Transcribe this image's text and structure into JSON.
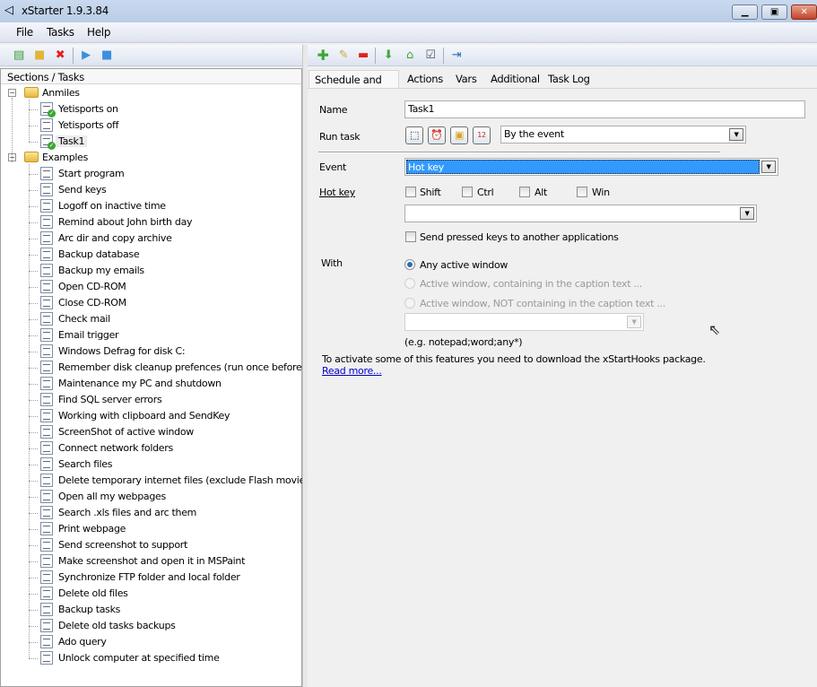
{
  "window": {
    "title": "xStarter 1.9.3.84",
    "controls": [
      "minimize",
      "maximize",
      "close"
    ]
  },
  "menu": [
    "File",
    "Tasks",
    "Help"
  ],
  "left_toolbar": [
    {
      "icon": "new-task-icon"
    },
    {
      "icon": "new-section-icon"
    },
    {
      "icon": "delete-icon"
    },
    {
      "icon": "run-icon"
    },
    {
      "icon": "stop-icon"
    }
  ],
  "right_toolbar": [
    {
      "icon": "add-icon"
    },
    {
      "icon": "edit-icon"
    },
    {
      "icon": "remove-icon"
    },
    {
      "icon": "move-down-icon"
    },
    {
      "icon": "move-up-icon"
    },
    {
      "icon": "checklist-icon"
    },
    {
      "icon": "step-run-icon"
    }
  ],
  "tree": {
    "header": "Sections / Tasks",
    "sections": [
      {
        "label": "Anmiles",
        "items": [
          {
            "label": "Yetisports on",
            "enabled": true
          },
          {
            "label": "Yetisports off",
            "enabled": false
          },
          {
            "label": "Task1",
            "enabled": true,
            "selected": true
          }
        ]
      },
      {
        "label": "Examples",
        "items": [
          {
            "label": "Start program"
          },
          {
            "label": "Send keys"
          },
          {
            "label": "Logoff on inactive time"
          },
          {
            "label": "Remind about John birth day"
          },
          {
            "label": "Arc dir and copy archive"
          },
          {
            "label": "Backup database"
          },
          {
            "label": "Backup my emails"
          },
          {
            "label": "Open CD-ROM"
          },
          {
            "label": "Close CD-ROM"
          },
          {
            "label": "Check mail"
          },
          {
            "label": "Email trigger"
          },
          {
            "label": "Windows Defrag for disk C:"
          },
          {
            "label": "Remember disk cleanup prefences (run once before ..."
          },
          {
            "label": "Maintenance my PC and shutdown"
          },
          {
            "label": "Find SQL server errors"
          },
          {
            "label": "Working with clipboard and SendKey"
          },
          {
            "label": "ScreenShot of active window"
          },
          {
            "label": "Connect network folders"
          },
          {
            "label": "Search files"
          },
          {
            "label": "Delete temporary internet files (exclude Flash movies)"
          },
          {
            "label": "Open all my webpages"
          },
          {
            "label": "Search .xls files and arc them"
          },
          {
            "label": "Print webpage"
          },
          {
            "label": "Send screenshot to support"
          },
          {
            "label": "Make screenshot and open it in MSPaint"
          },
          {
            "label": "Synchronize FTP folder and local folder"
          },
          {
            "label": "Delete old files"
          },
          {
            "label": "Backup tasks"
          },
          {
            "label": "Delete old tasks backups"
          },
          {
            "label": "Ado query"
          },
          {
            "label": "Unlock computer at specified time"
          }
        ]
      }
    ]
  },
  "tabs": [
    {
      "label": "Schedule and info",
      "active": true
    },
    {
      "label": "Actions"
    },
    {
      "label": "Vars"
    },
    {
      "label": "Additional"
    },
    {
      "label": "Task Log"
    }
  ],
  "form": {
    "name_label": "Name",
    "name_value": "Task1",
    "run_label": "Run task",
    "run_value": "By the event",
    "event_label": "Event",
    "event_value": "Hot key",
    "hotkey_label": "Hot key",
    "modifiers": [
      "Shift",
      "Ctrl",
      "Alt",
      "Win"
    ],
    "hotkey_value": "",
    "send_keys_label": "Send pressed keys to another applications",
    "with_label": "With",
    "with_options": [
      {
        "label": "Any active window",
        "checked": true,
        "enabled": true
      },
      {
        "label": "Active window, containing in the caption text ...",
        "enabled": false
      },
      {
        "label": "Active window, NOT containing in the caption text ...",
        "enabled": false
      }
    ],
    "caption_value": "",
    "caption_hint": "(e.g. notepad;word;any*)",
    "info_text": "To activate some of this features you need to download the xStartHooks package.",
    "read_more": "Read more..."
  },
  "colors": {
    "selection": "#3399ff",
    "link": "#0000cc",
    "titlebar": "#c4d5ea"
  }
}
